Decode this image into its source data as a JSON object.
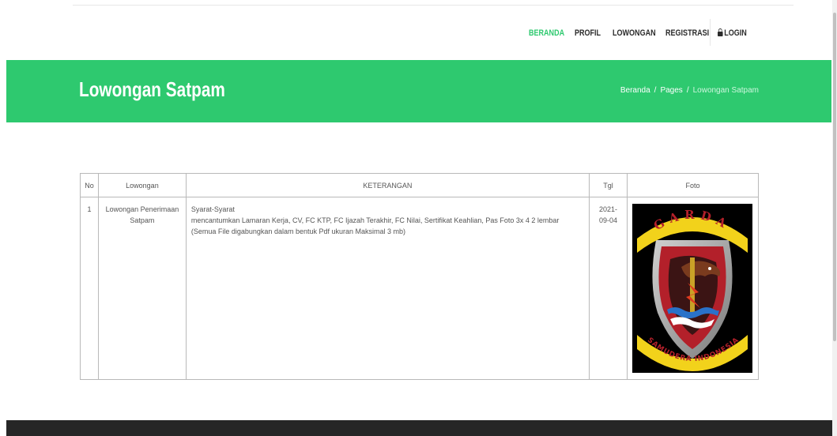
{
  "nav": {
    "items": [
      {
        "label": "BERANDA",
        "active": true
      },
      {
        "label": "PROFIL",
        "active": false
      },
      {
        "label": "LOWONGAN",
        "active": false
      },
      {
        "label": "REGISTRASI",
        "active": false
      }
    ],
    "login_label": "LOGIN",
    "login_icon": "lock-icon"
  },
  "banner": {
    "title": "Lowongan Satpam",
    "breadcrumb": [
      "Beranda",
      "Pages",
      "Lowongan Satpam"
    ],
    "color": "#2ec96f"
  },
  "table": {
    "headers": {
      "no": "No",
      "lowongan": "Lowongan",
      "keterangan": "KETERANGAN",
      "tgl": "Tgl",
      "foto": "Foto"
    },
    "rows": [
      {
        "no": "1",
        "lowongan": "Lowongan Penerimaan Satpam",
        "keterangan_title": "Syarat-Syarat",
        "keterangan_body": "mencantumkan Lamaran Kerja, CV, FC KTP, FC Ijazah Terakhir, FC Nilai, Sertifikat Keahlian, Pas Foto 3x 4 2 lembar (Semua File digabungkan dalam bentuk Pdf ukuran Maksimal 3 mb)",
        "tgl": "2021-09-04",
        "foto": {
          "top_text": "GARDA",
          "bottom_text": "SAMUDERA INDONESIA"
        }
      }
    ]
  },
  "colors": {
    "accent": "#2ec96f",
    "footer": "#262626"
  }
}
